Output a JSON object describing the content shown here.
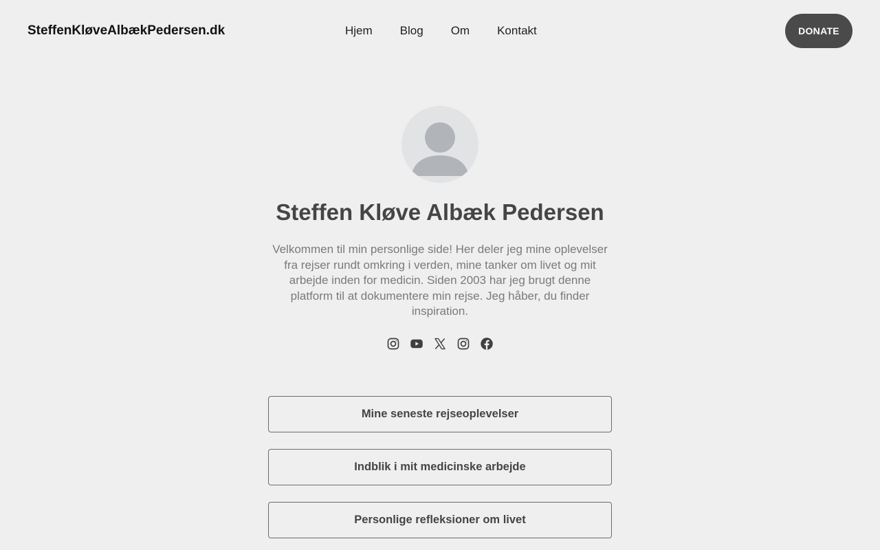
{
  "header": {
    "site_title": "SteffenKløveAlbækPedersen.dk",
    "nav": [
      "Hjem",
      "Blog",
      "Om",
      "Kontakt"
    ],
    "donate_label": "DONATE"
  },
  "profile": {
    "avatar_icon": "user-silhouette-icon",
    "name": "Steffen Kløve Albæk Pedersen",
    "bio": "Velkommen til min personlige side! Her deler jeg mine oplevelser fra rejser rundt omkring i verden, mine tanker om livet og mit arbejde inden for medicin. Siden 2003 har jeg brugt denne platform til at dokumentere min rejse. Jeg håber, du finder inspiration."
  },
  "social": [
    "instagram-icon",
    "youtube-icon",
    "x-icon",
    "instagram-icon",
    "facebook-icon"
  ],
  "links": [
    "Mine seneste rejseoplevelser",
    "Indblik i mit medicinske arbejde",
    "Personlige refleksioner om livet"
  ],
  "colors": {
    "background": "#efefef",
    "donate_bg": "#4a4a4a",
    "avatar_bg": "#e2e3e5",
    "avatar_figure": "#b1b5ba"
  }
}
